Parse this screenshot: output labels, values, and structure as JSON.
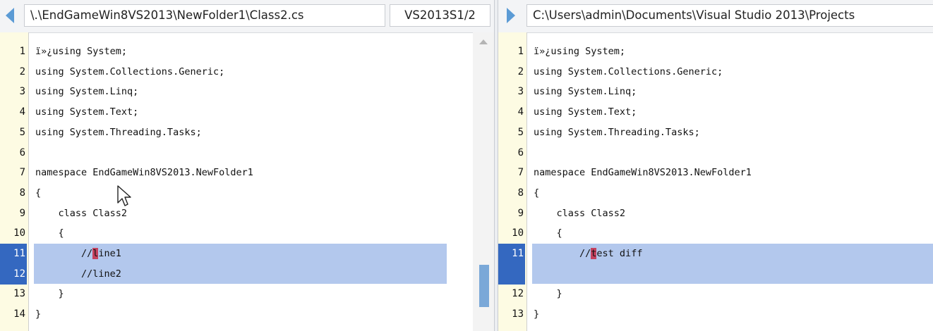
{
  "left": {
    "path": "\\.\\EndGameWin8VS2013\\NewFolder1\\Class2.cs",
    "branch": "VS2013S1/2",
    "lines": [
      {
        "num": "1",
        "text": "ï»¿using System;"
      },
      {
        "num": "2",
        "text": "using System.Collections.Generic;"
      },
      {
        "num": "3",
        "text": "using System.Linq;"
      },
      {
        "num": "4",
        "text": "using System.Text;"
      },
      {
        "num": "5",
        "text": "using System.Threading.Tasks;"
      },
      {
        "num": "6",
        "text": ""
      },
      {
        "num": "7",
        "text": "namespace EndGameWin8VS2013.NewFolder1"
      },
      {
        "num": "8",
        "text": "{"
      },
      {
        "num": "9",
        "text": "    class Class2"
      },
      {
        "num": "10",
        "text": "    {"
      },
      {
        "num": "11",
        "pre": "        //",
        "mark": "l",
        "post": "ine1"
      },
      {
        "num": "12",
        "text": "        //line2"
      },
      {
        "num": "13",
        "text": "    }"
      },
      {
        "num": "14",
        "text": "}"
      }
    ]
  },
  "right": {
    "path": "C:\\Users\\admin\\Documents\\Visual Studio 2013\\Projects",
    "lines": [
      {
        "num": "1",
        "text": "ï»¿using System;"
      },
      {
        "num": "2",
        "text": "using System.Collections.Generic;"
      },
      {
        "num": "3",
        "text": "using System.Linq;"
      },
      {
        "num": "4",
        "text": "using System.Text;"
      },
      {
        "num": "5",
        "text": "using System.Threading.Tasks;"
      },
      {
        "num": "6",
        "text": ""
      },
      {
        "num": "7",
        "text": "namespace EndGameWin8VS2013.NewFolder1"
      },
      {
        "num": "8",
        "text": "{"
      },
      {
        "num": "9",
        "text": "    class Class2"
      },
      {
        "num": "10",
        "text": "    {"
      },
      {
        "num": "11",
        "pre": "        //",
        "mark": "t",
        "post": "est diff"
      },
      {
        "num": "12",
        "text": "    }"
      },
      {
        "num": "13",
        "text": "}"
      }
    ]
  },
  "icons": {
    "left_nav": "previous-difference-arrow-icon",
    "right_nav": "next-difference-arrow-icon",
    "cursor": "mouse-pointer-icon",
    "scroll_up": "scroll-up-arrow-icon"
  },
  "colors": {
    "accent": "#5b9bd5",
    "gutter_bg": "#fdfbe3",
    "diff_highlight": "#b3c8ed",
    "selected_line_number": "#3468c0",
    "change_marker": "#c5425f"
  }
}
